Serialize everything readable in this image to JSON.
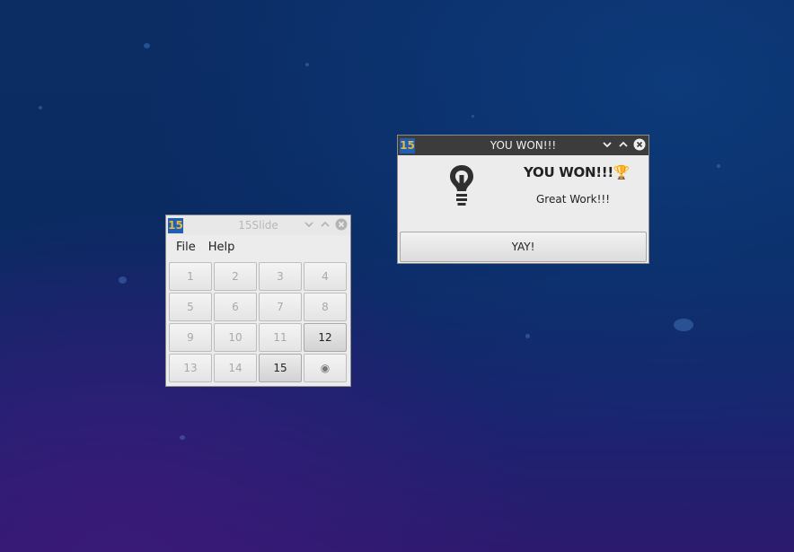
{
  "desktop": {
    "background_color": "#0b2a63"
  },
  "slide_window": {
    "badge": "15",
    "title": "15Slide",
    "menu": [
      "File",
      "Help"
    ],
    "tiles": [
      {
        "label": "1"
      },
      {
        "label": "2"
      },
      {
        "label": "3"
      },
      {
        "label": "4"
      },
      {
        "label": "5"
      },
      {
        "label": "6"
      },
      {
        "label": "7"
      },
      {
        "label": "8"
      },
      {
        "label": "9"
      },
      {
        "label": "10"
      },
      {
        "label": "11"
      },
      {
        "label": "12"
      },
      {
        "label": "13"
      },
      {
        "label": "14"
      },
      {
        "label": "15"
      },
      {
        "label": "◉"
      }
    ],
    "active_tiles": [
      "12",
      "15"
    ]
  },
  "won_dialog": {
    "badge": "15",
    "title": "YOU WON!!!",
    "heading": "YOU WON!!!🏆",
    "message": "Great Work!!!",
    "button_label": "YAY!",
    "icon": "lightbulb-icon"
  },
  "colors": {
    "active_titlebar": "#3c3c3c",
    "inactive_titlebar": "#e8e8e8",
    "badge_bg": "#1f5fb8",
    "badge_fg": "#e8b93a"
  }
}
